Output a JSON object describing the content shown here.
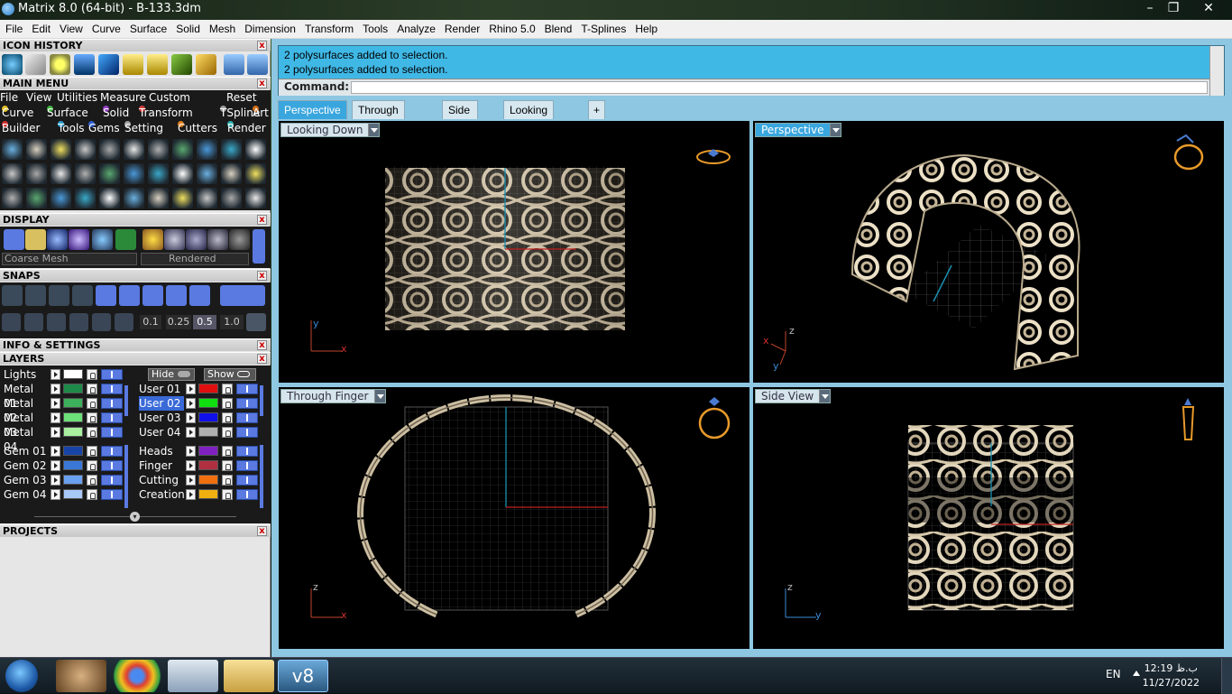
{
  "window": {
    "title": "Matrix 8.0 (64-bit) - B-133.3dm",
    "min": "–",
    "max": "❐",
    "close": "✕"
  },
  "menubar": [
    "File",
    "Edit",
    "View",
    "Curve",
    "Surface",
    "Solid",
    "Mesh",
    "Dimension",
    "Transform",
    "Tools",
    "Analyze",
    "Render",
    "Rhino 5.0",
    "Blend",
    "T-Splines",
    "Help"
  ],
  "panels": {
    "icon_history": "ICON HISTORY",
    "main_menu": "MAIN MENU",
    "display": "DISPLAY",
    "snaps": "SNAPS",
    "info_settings": "INFO & SETTINGS",
    "layers": "LAYERS",
    "projects": "PROJECTS"
  },
  "main_menu_bar": {
    "file": "File",
    "view": "View",
    "utilities": "Utilities",
    "measure": "Measure",
    "custom": "Custom",
    "reset": "Reset"
  },
  "categories_row1": [
    {
      "label": "Curve",
      "color": "#e0c030"
    },
    {
      "label": "Surface",
      "color": "#40b040"
    },
    {
      "label": "Solid",
      "color": "#9040c0"
    },
    {
      "label": "Transform",
      "color": "#d04040"
    },
    {
      "label": "TSpline",
      "color": "#a0a0a0"
    },
    {
      "label": "Art",
      "color": "#d07020"
    }
  ],
  "categories_row2": [
    {
      "label": "Builder",
      "color": "#d03030"
    },
    {
      "label": "Tools",
      "color": "#30a0d0"
    },
    {
      "label": "Gems",
      "color": "#3060d0"
    },
    {
      "label": "Setting",
      "color": "#a0a0a0"
    },
    {
      "label": "Cutters",
      "color": "#e08020"
    },
    {
      "label": "Render",
      "color": "#30b0b0"
    }
  ],
  "display": {
    "mesh": "Coarse Mesh",
    "mode": "Rendered"
  },
  "snaps": {
    "values": [
      "0.1",
      "0.25",
      "0.5",
      "1.0"
    ]
  },
  "layers": {
    "lights": "Lights",
    "hide": "Hide",
    "show": "Show",
    "left": [
      {
        "name": "Metal 01",
        "color": "#1e8a4a"
      },
      {
        "name": "Metal 02",
        "color": "#3cb05a"
      },
      {
        "name": "Metal 03",
        "color": "#6ee07a"
      },
      {
        "name": "Metal 04",
        "color": "#a8f0a0"
      },
      {
        "name": "Gem 01",
        "color": "#1844a8"
      },
      {
        "name": "Gem 02",
        "color": "#3a78d8"
      },
      {
        "name": "Gem 03",
        "color": "#6aa0f0"
      },
      {
        "name": "Gem 04",
        "color": "#a8c8f8"
      }
    ],
    "right": [
      {
        "name": "User 01",
        "color": "#e01010"
      },
      {
        "name": "User 02",
        "color": "#10e010"
      },
      {
        "name": "User 03",
        "color": "#1010e8"
      },
      {
        "name": "User 04",
        "color": "#b0b0b0"
      },
      {
        "name": "Heads",
        "color": "#8020c0"
      },
      {
        "name": "Finger",
        "color": "#b03040"
      },
      {
        "name": "Cutting",
        "color": "#f07010"
      },
      {
        "name": "Creation",
        "color": "#f0b010"
      }
    ]
  },
  "command": {
    "line1": "2 polysurfaces added to selection.",
    "line2": "2 polysurfaces added to selection.",
    "prompt": "Command:",
    "input": ""
  },
  "view_tabs": [
    "Perspective",
    "Through Finger",
    "Side View",
    "Looking Down",
    "+"
  ],
  "viewports": {
    "top_left": "Looking Down",
    "top_right": "Perspective",
    "bottom_left": "Through Finger",
    "bottom_right": "Side View"
  },
  "axes": {
    "x": "x",
    "y": "y",
    "z": "z"
  },
  "taskbar": {
    "lang": "EN",
    "time": "12:19 ب.ظ",
    "date": "11/27/2022",
    "v8": "v8"
  }
}
